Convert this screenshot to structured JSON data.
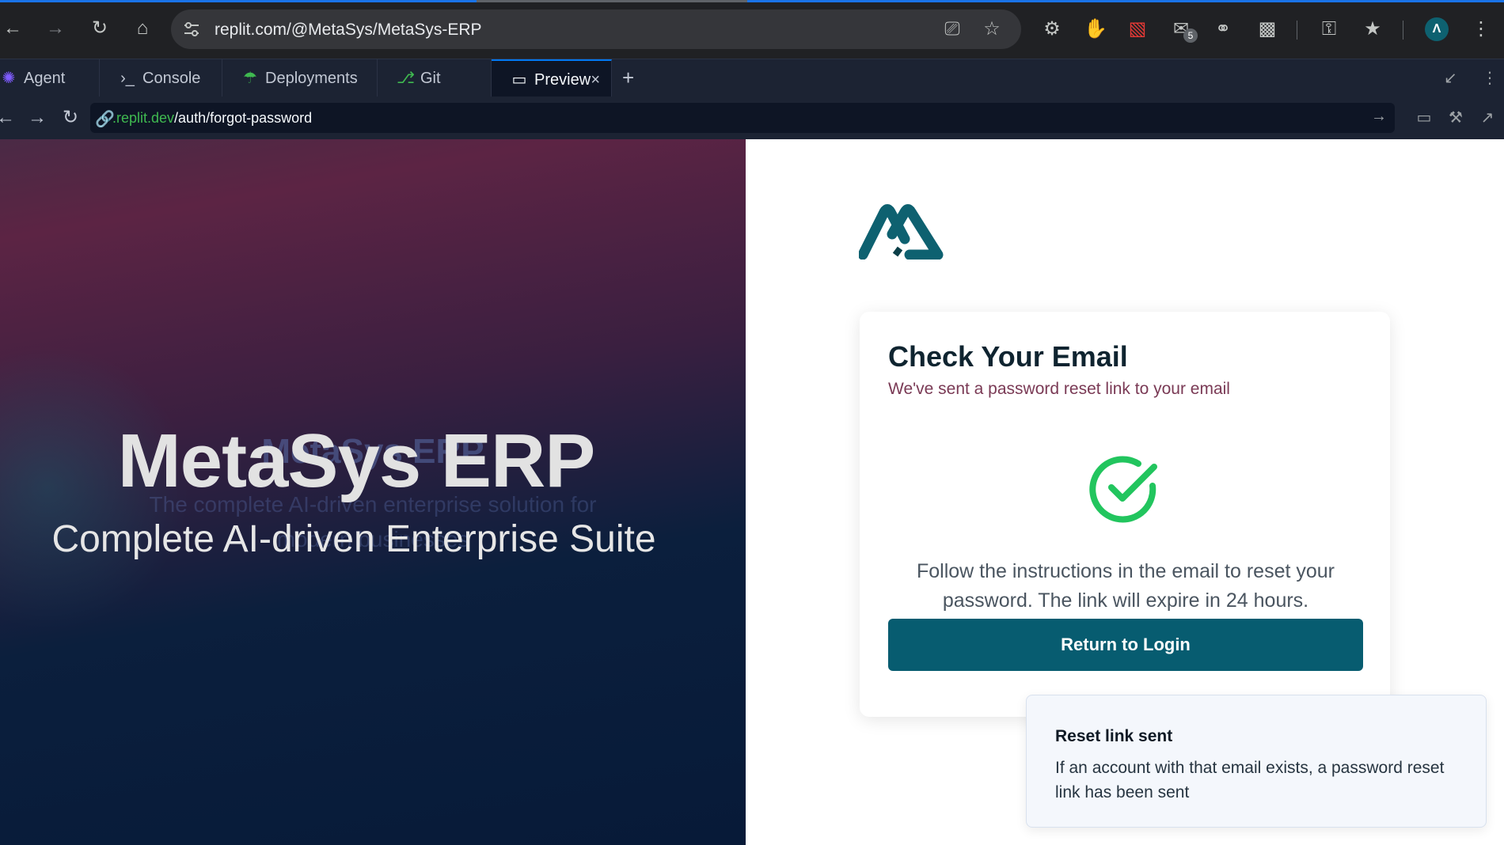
{
  "browser": {
    "url": "replit.com/@MetaSys/MetaSys-ERP",
    "extension_badge": "5",
    "colors": {
      "chrome": "#202124",
      "omnibox": "#35363a",
      "accent": "#1a73e8"
    }
  },
  "workspace": {
    "tabs": [
      {
        "label": "Agent",
        "icon": "agent-icon"
      },
      {
        "label": "Console",
        "icon": "console-icon"
      },
      {
        "label": "Deployments",
        "icon": "deployments-icon"
      },
      {
        "label": "Git",
        "icon": "git-icon"
      },
      {
        "label": "Preview",
        "icon": "monitor-icon",
        "active": true
      }
    ],
    "preview_url": {
      "host": ".replit.dev",
      "path": "/auth/forgot-password"
    }
  },
  "hero": {
    "title": "MetaSys ERP",
    "subtitle": "Complete AI-driven Enterprise Suite",
    "ghost_title": "MetaSys ERP",
    "ghost_line1": "The complete AI-driven enterprise solution for",
    "ghost_line2": "modern businesses"
  },
  "card": {
    "title": "Check Your Email",
    "subtitle": "We've sent a password reset link to your email",
    "message": "Follow the instructions in the email to reset your password. The link will expire in 24 hours.",
    "button": "Return to Login",
    "colors": {
      "button": "#075c70",
      "check": "#22c55e",
      "logo": "#0e6170"
    }
  },
  "toast": {
    "title": "Reset link sent",
    "message": "If an account with that email exists, a password reset link has been sent"
  }
}
